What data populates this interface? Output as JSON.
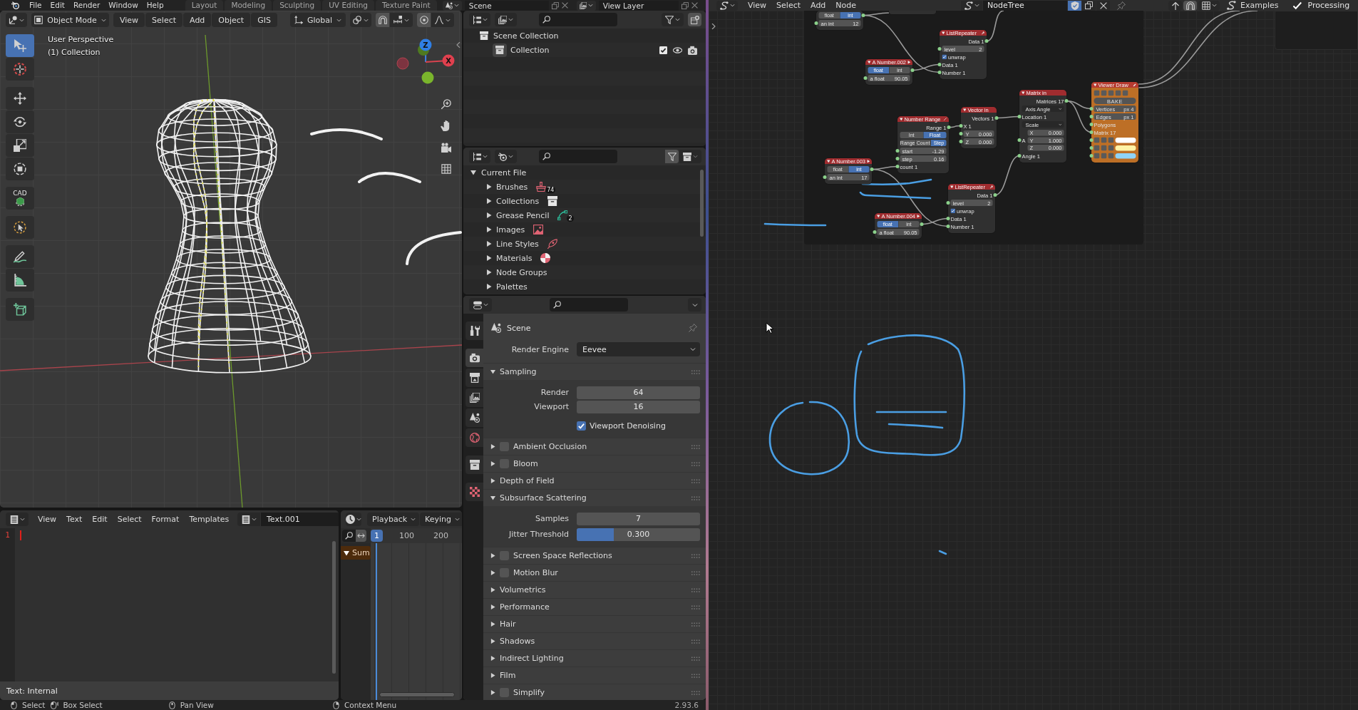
{
  "top_bar": {
    "menus": [
      "File",
      "Edit",
      "Render",
      "Window",
      "Help"
    ],
    "workspaces": [
      {
        "label": "Layout",
        "selected": false
      },
      {
        "label": "Modeling",
        "selected": false
      },
      {
        "label": "Sculpting",
        "selected": false
      },
      {
        "label": "UV Editing",
        "selected": false
      },
      {
        "label": "Texture Paint",
        "selected": false
      }
    ],
    "scene": "Scene",
    "view_layer": "View Layer"
  },
  "viewport": {
    "mode": "Object Mode",
    "menus": [
      "View",
      "Select",
      "Add",
      "Object",
      "GIS"
    ],
    "orientation": "Global",
    "overlay": [
      "User Perspective",
      "(1) Collection"
    ],
    "tools": [
      {
        "kind": "select-box",
        "selected": true
      },
      {
        "kind": "cursor",
        "selected": false
      },
      {
        "kind": "move",
        "selected": false
      },
      {
        "kind": "rotate",
        "selected": false
      },
      {
        "kind": "scale",
        "selected": false
      },
      {
        "kind": "transform",
        "selected": false
      },
      {
        "kind": "cad",
        "label": "CAD",
        "selected": false
      },
      {
        "kind": "select-circle",
        "selected": false
      },
      {
        "kind": "annotate",
        "selected": false
      },
      {
        "kind": "measure",
        "selected": false
      },
      {
        "kind": "add-cube",
        "selected": false
      }
    ],
    "gizmo": [
      "Z",
      "X"
    ]
  },
  "text_editor": {
    "menus": [
      "View",
      "Text",
      "Edit",
      "Select",
      "Format",
      "Templates"
    ],
    "text_name": "Text.001",
    "line_numbers": [
      "1"
    ],
    "footer": "Text: Internal"
  },
  "timeline": {
    "menus": [
      "Playback",
      "Keying"
    ],
    "current_frame": "1",
    "frame_labels": [
      "100",
      "200"
    ],
    "channels": [
      {
        "label": "Sum",
        "expanded": true
      }
    ]
  },
  "outliner": {
    "items": [
      {
        "label": "Scene Collection",
        "children": [
          {
            "label": "Collection",
            "checked": true
          }
        ]
      }
    ]
  },
  "blend_data": {
    "root": {
      "label": "Current File",
      "expanded": true
    },
    "items": [
      {
        "label": "Brushes",
        "kind": "brush",
        "count": "74",
        "expanded": false
      },
      {
        "label": "Collections",
        "kind": "collection",
        "expanded": false
      },
      {
        "label": "Grease Pencil",
        "kind": "grease-pencil",
        "count": "2",
        "expanded": false
      },
      {
        "label": "Images",
        "kind": "image",
        "expanded": false
      },
      {
        "label": "Line Styles",
        "kind": "line-style",
        "expanded": false
      },
      {
        "label": "Materials",
        "kind": "material",
        "expanded": false
      },
      {
        "label": "Node Groups",
        "expanded": false
      },
      {
        "label": "Palettes",
        "expanded": false
      }
    ]
  },
  "properties": {
    "tabs": [
      {
        "kind": "tool",
        "selected": false
      },
      {
        "kind": "render",
        "selected": true
      },
      {
        "kind": "output",
        "selected": false
      },
      {
        "kind": "view-layer",
        "selected": false
      },
      {
        "kind": "scene",
        "selected": false
      },
      {
        "kind": "world",
        "selected": false
      },
      {
        "kind": "collection",
        "selected": false
      },
      {
        "kind": "texture",
        "selected": false
      }
    ],
    "context": "Scene",
    "render_engine": {
      "label": "Render Engine",
      "value": "Eevee"
    },
    "panels": [
      {
        "title": "Sampling",
        "expanded": true,
        "fields": [
          {
            "kind": "number",
            "label": "Render",
            "value": "64"
          },
          {
            "kind": "number",
            "label": "Viewport",
            "value": "16"
          },
          {
            "kind": "checkbox",
            "label": "Viewport Denoising",
            "checked": true
          }
        ]
      },
      {
        "title": "Ambient Occlusion",
        "expanded": false,
        "enabled": false
      },
      {
        "title": "Bloom",
        "expanded": false,
        "enabled": false
      },
      {
        "title": "Depth of Field",
        "expanded": false
      },
      {
        "title": "Subsurface Scattering",
        "expanded": true,
        "fields": [
          {
            "kind": "number",
            "label": "Samples",
            "value": "7"
          },
          {
            "kind": "slider",
            "label": "Jitter Threshold",
            "value": "0.300",
            "level": 0.3
          }
        ]
      },
      {
        "title": "Screen Space Reflections",
        "expanded": false,
        "enabled": false
      },
      {
        "title": "Motion Blur",
        "expanded": false,
        "enabled": false
      },
      {
        "title": "Volumetrics",
        "expanded": false
      },
      {
        "title": "Performance",
        "expanded": false
      },
      {
        "title": "Hair",
        "expanded": false
      },
      {
        "title": "Shadows",
        "expanded": false
      },
      {
        "title": "Indirect Lighting",
        "expanded": false
      },
      {
        "title": "Film",
        "expanded": false
      },
      {
        "title": "Simplify",
        "expanded": false,
        "enabled": false
      }
    ]
  },
  "status_bar": {
    "items": [
      {
        "kind": "mouse-left",
        "label": "Select"
      },
      {
        "kind": "mouse-drag",
        "label": "Box Select"
      },
      {
        "kind": "mouse-middle",
        "label": "Pan View"
      },
      {
        "kind": "mouse-right",
        "label": "Context Menu"
      }
    ],
    "version": "2.93.6"
  },
  "node_editor": {
    "menus": [
      "View",
      "Select",
      "Add",
      "Node"
    ],
    "tree_name": "NodeTree",
    "fake_user": true,
    "addons": [
      {
        "kind": "examples",
        "label": "Examples"
      },
      {
        "kind": "processing",
        "label": "Processing",
        "checked": true
      }
    ],
    "nodes": [
      {
        "kind": "number",
        "rows": [
          {
            "kind": "toggle",
            "options": [
              {
                "label": "float",
                "selected": false
              },
              {
                "label": "int",
                "selected": true
              }
            ]
          },
          {
            "kind": "field",
            "label": "an int",
            "value": "12"
          }
        ]
      },
      {
        "kind": "cut-off"
      },
      {
        "kind": "list",
        "title": "ListRepeater",
        "rows": [
          {
            "kind": "output",
            "label": "Data 1"
          },
          {
            "kind": "field",
            "label": "level",
            "value": "2"
          },
          {
            "kind": "checkbox",
            "label": "unwrap",
            "checked": true
          },
          {
            "kind": "input",
            "label": "Data 1"
          },
          {
            "kind": "input",
            "label": "Number 1"
          }
        ]
      },
      {
        "kind": "number",
        "title": "A Number.002",
        "rows": [
          {
            "kind": "toggle",
            "options": [
              {
                "label": "float",
                "selected": true
              },
              {
                "label": "int",
                "selected": false
              }
            ]
          },
          {
            "kind": "field",
            "label": "a float",
            "value": "90.05"
          }
        ]
      },
      {
        "kind": "range",
        "title": "Number Range",
        "rows": [
          {
            "kind": "output",
            "label": "Range 1"
          },
          {
            "kind": "toggle",
            "options": [
              {
                "label": "Int",
                "selected": false
              },
              {
                "label": "Float",
                "selected": true
              }
            ]
          },
          {
            "kind": "toggle",
            "options": [
              {
                "label": "Range",
                "selected": false
              },
              {
                "label": "Count",
                "selected": false
              },
              {
                "label": "Step",
                "selected": true
              }
            ]
          },
          {
            "kind": "field",
            "label": "start",
            "value": "-1.29"
          },
          {
            "kind": "field",
            "label": "step",
            "value": "0.16"
          },
          {
            "kind": "input",
            "label": "count 1"
          }
        ]
      },
      {
        "kind": "vector",
        "title": "Vector in",
        "rows": [
          {
            "kind": "output",
            "label": "Vectors 1"
          },
          {
            "kind": "input",
            "label": "X 1"
          },
          {
            "kind": "field",
            "label": "Y",
            "value": "0.000"
          },
          {
            "kind": "field",
            "label": "Z",
            "value": "0.000"
          }
        ]
      },
      {
        "kind": "matrix",
        "title": "Matrix in",
        "rows": [
          {
            "kind": "output",
            "label": "Matrices 17"
          },
          {
            "kind": "dropdown",
            "value": "Axis Angle"
          },
          {
            "kind": "input",
            "label": "Location 1"
          },
          {
            "kind": "dropdown",
            "value": "Scale"
          },
          {
            "kind": "vector",
            "label": "A",
            "items": [
              {
                "label": "X",
                "value": "0.000"
              },
              {
                "label": "Y",
                "value": "1.000"
              },
              {
                "label": "Z",
                "value": "0.000"
              }
            ]
          },
          {
            "kind": "input",
            "label": "Angle 1"
          }
        ]
      },
      {
        "kind": "viewer",
        "title": "Viewer Draw",
        "rows": [
          {
            "kind": "icons"
          },
          {
            "kind": "button",
            "label": "BAKE"
          },
          {
            "kind": "field",
            "label": "Vertices",
            "value": "px 4"
          },
          {
            "kind": "field",
            "label": "Edges",
            "value": "px 1"
          },
          {
            "kind": "input",
            "label": "Polygons"
          },
          {
            "kind": "input",
            "label": "Matrix 17"
          },
          {
            "kind": "color",
            "color": "#ffffff"
          },
          {
            "kind": "color",
            "color": "#fff3a6"
          },
          {
            "kind": "color",
            "color": "#8fd3f7"
          }
        ]
      },
      {
        "kind": "number",
        "title": "A Number.003",
        "rows": [
          {
            "kind": "toggle",
            "options": [
              {
                "label": "float",
                "selected": false
              },
              {
                "label": "int",
                "selected": true
              }
            ]
          },
          {
            "kind": "field",
            "label": "an int",
            "value": "17"
          }
        ]
      },
      {
        "kind": "list",
        "title": "ListRepeater",
        "rows": [
          {
            "kind": "output",
            "label": "Data 1"
          },
          {
            "kind": "field",
            "label": "level",
            "value": "2"
          },
          {
            "kind": "checkbox",
            "label": "unwrap",
            "checked": true
          },
          {
            "kind": "input",
            "label": "Data 1"
          },
          {
            "kind": "input",
            "label": "Number 1"
          }
        ]
      },
      {
        "kind": "number",
        "title": "A Number.004",
        "rows": [
          {
            "kind": "toggle",
            "options": [
              {
                "label": "float",
                "selected": true
              },
              {
                "label": "int",
                "selected": false
              }
            ]
          },
          {
            "kind": "field",
            "label": "a float",
            "value": "90.05"
          }
        ]
      }
    ]
  }
}
